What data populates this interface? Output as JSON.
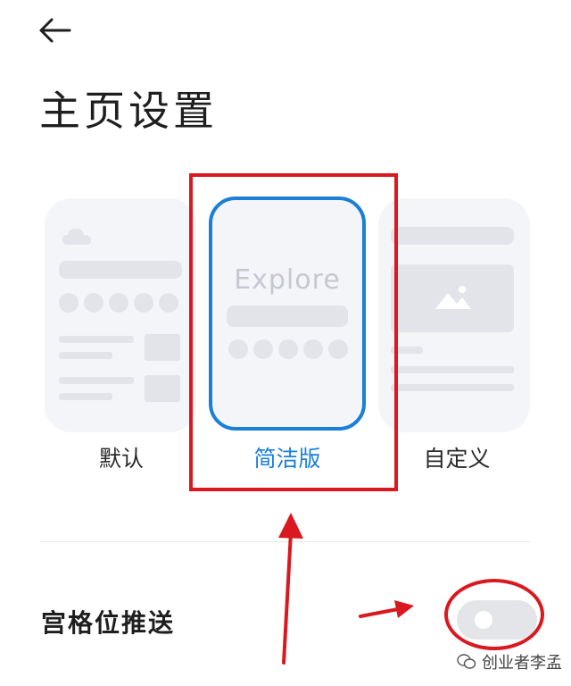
{
  "header": {
    "back_icon": "back-arrow-icon",
    "title": "主页设置"
  },
  "layouts": {
    "default": {
      "label": "默认"
    },
    "simple": {
      "label": "简洁版",
      "preview_text": "Explore",
      "selected": true
    },
    "custom": {
      "label": "自定义"
    }
  },
  "settings": {
    "grid_push": {
      "label": "宫格位推送",
      "enabled": false
    }
  },
  "watermark": {
    "text": "创业者李孟",
    "icon": "wechat-icon"
  },
  "colors": {
    "accent": "#1a7fd6",
    "annotation": "#d9191f"
  }
}
